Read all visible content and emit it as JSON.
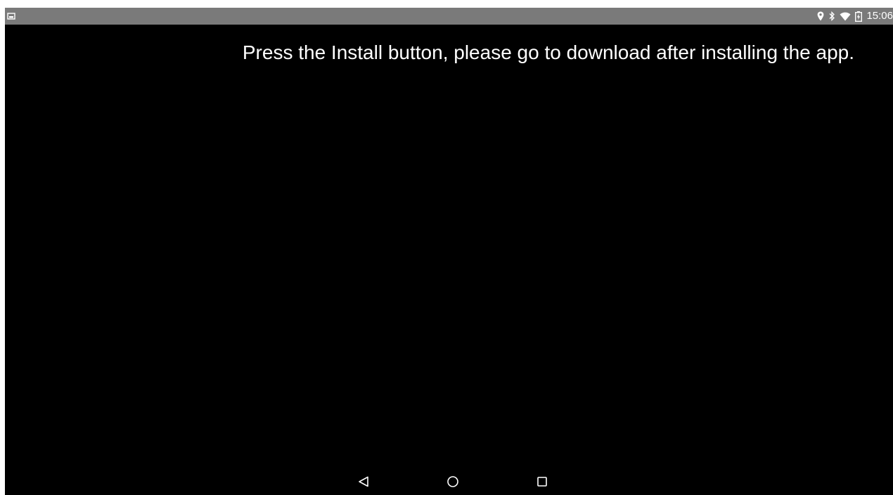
{
  "status_bar": {
    "left_icon": "image-notification-icon",
    "right_icons": [
      "location-icon",
      "bluetooth-icon",
      "wifi-icon",
      "battery-icon"
    ],
    "time": "15:06",
    "background_color": "#7a7a7a"
  },
  "main": {
    "message": "Press the Install button, please go to download after installing the app.",
    "background_color": "#000000",
    "text_color": "#ffffff"
  },
  "nav_bar": {
    "buttons": [
      {
        "name": "back",
        "icon": "back-triangle-icon"
      },
      {
        "name": "home",
        "icon": "home-circle-icon"
      },
      {
        "name": "recents",
        "icon": "recents-square-icon"
      }
    ]
  }
}
